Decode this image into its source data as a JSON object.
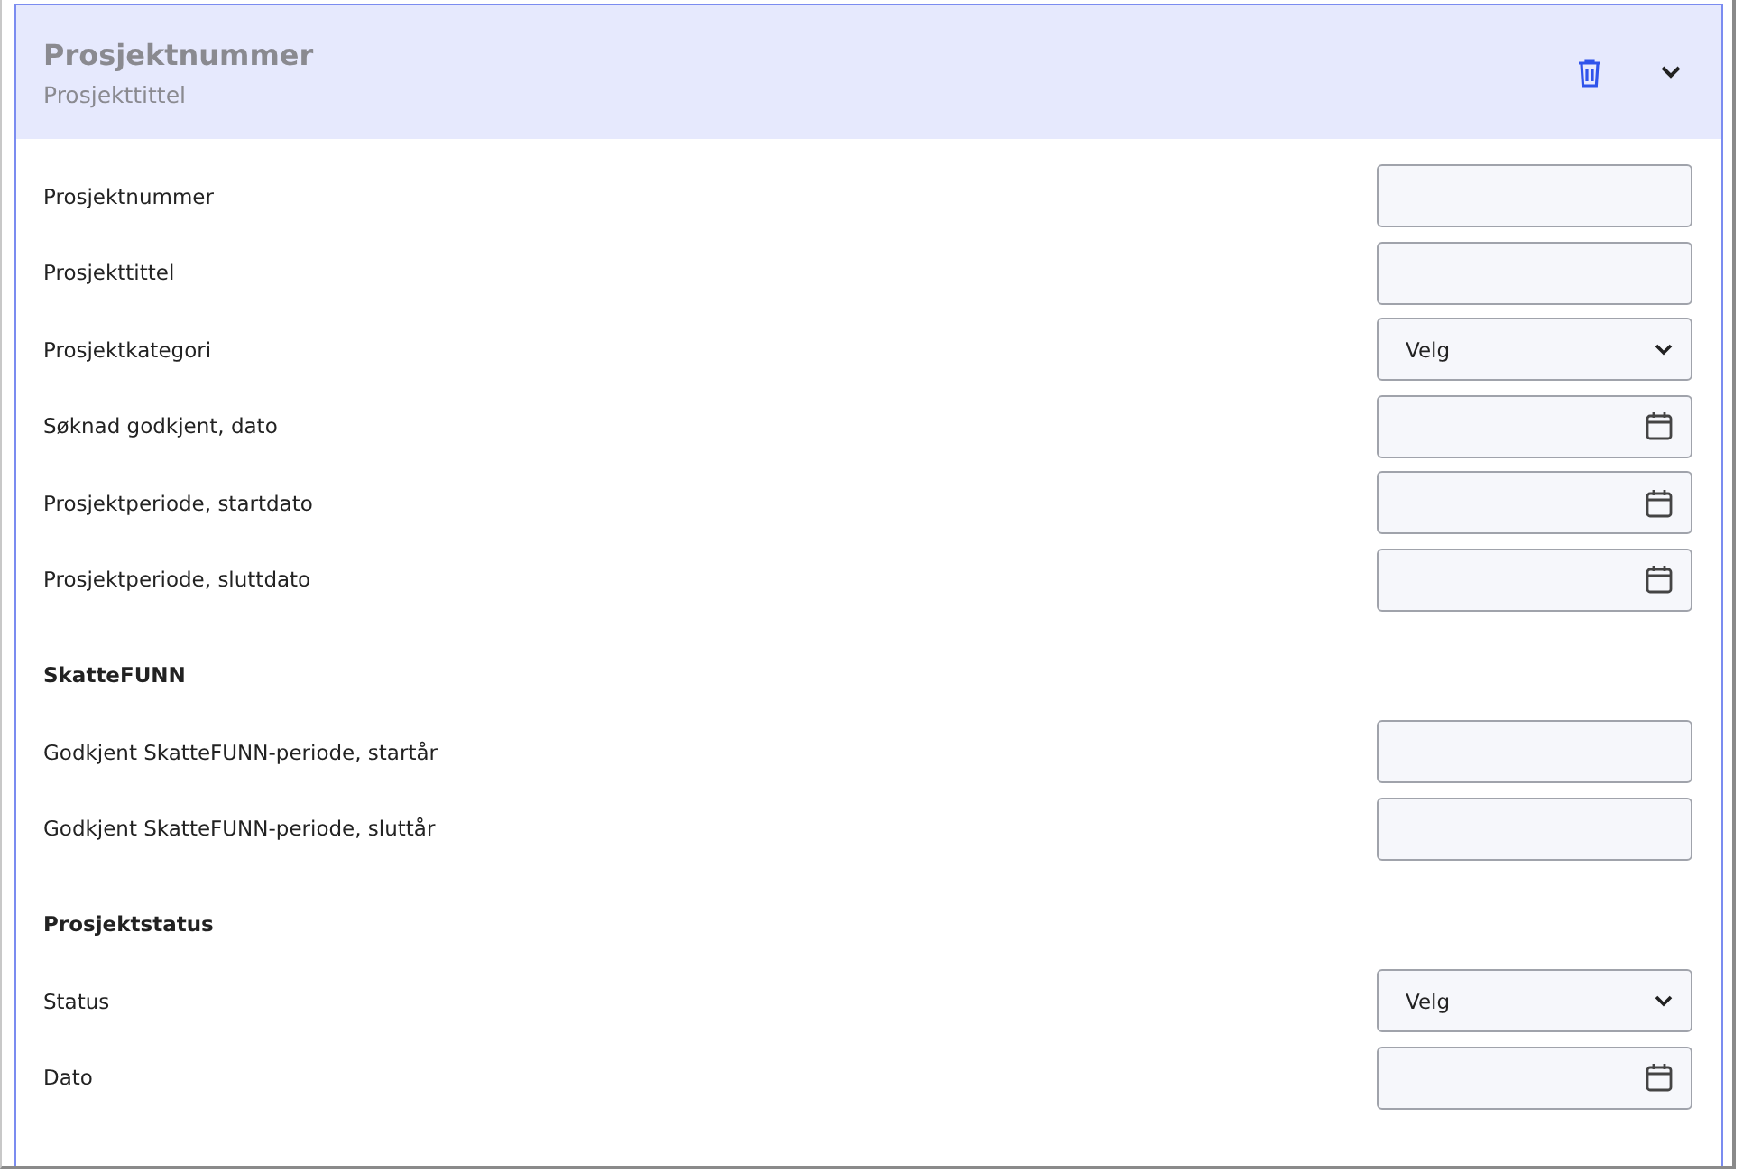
{
  "header": {
    "title": "Prosjektnummer",
    "subtitle": "Prosjekttittel",
    "expanded": true
  },
  "sections": [
    {
      "fields": [
        {
          "label": "Prosjektnummer",
          "kind": "text"
        },
        {
          "label": "Prosjekttittel",
          "kind": "text"
        },
        {
          "label": "Prosjektkategori",
          "kind": "select",
          "value": "Velg"
        },
        {
          "label": "Søknad godkjent, dato",
          "kind": "date"
        },
        {
          "label": "Prosjektperiode, startdato",
          "kind": "date"
        },
        {
          "label": "Prosjektperiode, sluttdato",
          "kind": "date"
        }
      ]
    },
    {
      "heading": "SkatteFUNN",
      "fields": [
        {
          "label": "Godkjent SkatteFUNN-periode, startår",
          "kind": "text"
        },
        {
          "label": "Godkjent SkatteFUNN-periode, sluttår",
          "kind": "text"
        }
      ]
    },
    {
      "heading": "Prosjektstatus",
      "fields": [
        {
          "label": "Status",
          "kind": "select",
          "value": "Velg"
        },
        {
          "label": "Dato",
          "kind": "date"
        }
      ]
    }
  ]
}
